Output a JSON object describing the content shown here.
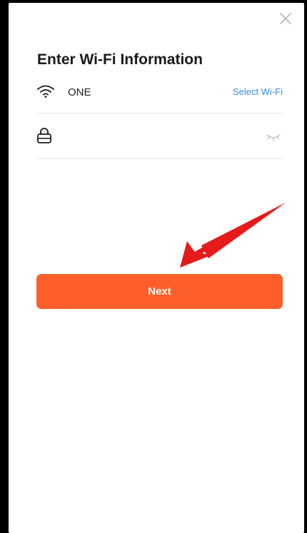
{
  "header": {
    "close_icon": "close-icon",
    "title": "Enter Wi-Fi Information"
  },
  "wifi": {
    "icon": "wifi-icon",
    "ssid": "ONE",
    "select_label": "Select Wi-Fi"
  },
  "password": {
    "icon": "lock-icon",
    "value": "",
    "placeholder": "",
    "toggle_icon": "eye-closed-icon"
  },
  "actions": {
    "next_label": "Next"
  },
  "annotation": {
    "icon": "red-arrow-pointer"
  },
  "colors": {
    "primary": "#fd5e2a",
    "link": "#3a8ee6",
    "annotation": "#e51b1b"
  }
}
